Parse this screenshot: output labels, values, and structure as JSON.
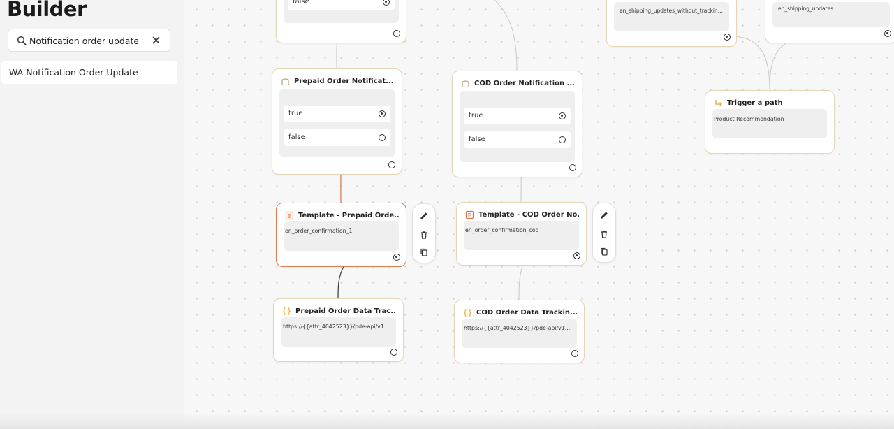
{
  "sidebar": {
    "title": "Builder",
    "search": {
      "value": "Notification order update",
      "placeholder": ""
    },
    "results": [
      "WA Notification Order Update"
    ]
  },
  "nodes": {
    "top_left": {
      "option_false": "false"
    },
    "top_right_a": {
      "text": "en_shipping_updates_without_trackin..."
    },
    "top_right_b": {
      "text": "en_shipping_updates"
    },
    "prepaid_condition": {
      "title": "Prepaid Order Notificat...",
      "option_true": "true",
      "option_false": "false"
    },
    "cod_condition": {
      "title": "COD Order Notification ...",
      "option_true": "true",
      "option_false": "false"
    },
    "trigger_path": {
      "title": "Trigger a path",
      "link": "Product Recommendation"
    },
    "prepaid_template": {
      "title": "Template - Prepaid Orde...",
      "text": "en_order_confirmation_1"
    },
    "cod_template": {
      "title": "Template - COD Order No...",
      "text": "en_order_confirmation_cod"
    },
    "prepaid_tracking": {
      "title": "Prepaid Order Data Trac...",
      "text": "https://{{attr_4042523}}/pde-api/v1...."
    },
    "cod_tracking": {
      "title": "COD Order Data Trackin...",
      "text": "https://{{attr_4042523}}/pde-api/v1...."
    }
  },
  "colors": {
    "node_border": "#e5d6b7",
    "selected_border": "#dd7e55",
    "template_icon": "#e0703f",
    "api_icon": "#e0a82e",
    "condition_icon": "#b8a47a",
    "active_edge": "#dd7e55",
    "edge": "#c8c8c8"
  },
  "icons": {
    "search": "search-icon",
    "clear": "close-icon",
    "condition": "branch-icon",
    "template": "template-icon",
    "api": "code-braces-icon",
    "trigger": "arrow-right-icon",
    "edit": "pencil-icon",
    "delete": "trash-icon",
    "copy": "copy-icon"
  }
}
